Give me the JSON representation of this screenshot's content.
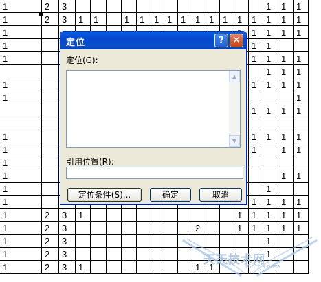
{
  "spreadsheet": {
    "rows": [
      [
        "1",
        "2",
        "3",
        "",
        "",
        "",
        "",
        "",
        "",
        "",
        "",
        "",
        "",
        "",
        "",
        "",
        "1",
        "1",
        "1"
      ],
      [
        "1",
        "2",
        "3",
        "1",
        "1",
        "",
        "1",
        "1",
        "1",
        "1",
        "1",
        "1",
        "1",
        "1",
        "1",
        "1",
        "1",
        "1",
        "1"
      ],
      [
        "1",
        "",
        "",
        "",
        "",
        "",
        "",
        "",
        "",
        "",
        "",
        "",
        "",
        "",
        "1",
        "1",
        "1",
        "1",
        "1"
      ],
      [
        "1",
        "",
        "",
        "",
        "",
        "",
        "",
        "",
        "",
        "",
        "",
        "",
        "",
        "",
        "1",
        "1",
        "1",
        "",
        ""
      ],
      [
        "1",
        "",
        "",
        "",
        "",
        "",
        "",
        "",
        "",
        "",
        "",
        "",
        "",
        "",
        "1",
        "1",
        "1",
        "1",
        "1"
      ],
      [
        "",
        "",
        "",
        "",
        "",
        "",
        "",
        "",
        "",
        "",
        "",
        "",
        "",
        "",
        "",
        "",
        "1",
        "1",
        "1"
      ],
      [
        "1",
        "",
        "",
        "",
        "",
        "",
        "",
        "",
        "",
        "",
        "",
        "",
        "",
        "",
        "1",
        "1",
        "1",
        "1",
        "1"
      ],
      [
        "1",
        "",
        "",
        "",
        "",
        "",
        "",
        "",
        "",
        "",
        "",
        "",
        "",
        "",
        "",
        "",
        "",
        "",
        "1"
      ],
      [
        "",
        "",
        "",
        "",
        "",
        "",
        "",
        "",
        "",
        "",
        "",
        "",
        "",
        "",
        "1",
        "1",
        "1",
        "1",
        "1"
      ],
      [
        "",
        "",
        "",
        "",
        "",
        "",
        "",
        "",
        "",
        "",
        "",
        "",
        "",
        "",
        "",
        "",
        "",
        "",
        ""
      ],
      [
        "1",
        "",
        "",
        "",
        "",
        "",
        "",
        "",
        "",
        "",
        "",
        "",
        "",
        "",
        "1",
        "1",
        "1",
        "1",
        "1"
      ],
      [
        "1",
        "",
        "",
        "",
        "",
        "",
        "",
        "",
        "",
        "",
        "",
        "",
        "",
        "",
        "1",
        "1",
        "",
        "1",
        "1"
      ],
      [
        "1",
        "",
        "",
        "",
        "",
        "",
        "",
        "",
        "",
        "",
        "",
        "",
        "",
        "",
        "1",
        "",
        "",
        "",
        ""
      ],
      [
        "1",
        "",
        "",
        "",
        "",
        "",
        "",
        "",
        "",
        "",
        "",
        "",
        "",
        "",
        "",
        "",
        "",
        "1",
        "1"
      ],
      [
        "1",
        "",
        "",
        "",
        "",
        "",
        "",
        "",
        "",
        "",
        "",
        "",
        "",
        "",
        "",
        "",
        "1",
        "",
        ""
      ],
      [
        "1",
        "",
        "",
        "",
        "",
        "",
        "",
        "",
        "",
        "",
        "",
        "",
        "",
        "",
        "1",
        "1",
        "1",
        "1",
        "1"
      ],
      [
        "1",
        "2",
        "3",
        "1",
        "",
        "",
        "",
        "",
        "",
        "",
        "",
        "",
        "",
        "",
        "1",
        "1",
        "1",
        "1",
        "1"
      ],
      [
        "1",
        "2",
        "3",
        "",
        "",
        "",
        "",
        "",
        "",
        "",
        "",
        "2",
        "",
        "",
        "1",
        "1",
        "1",
        "1",
        "1"
      ],
      [
        "1",
        "2",
        "3",
        "",
        "",
        "",
        "",
        "",
        "",
        "",
        "",
        "",
        "",
        "",
        "",
        "",
        "1",
        "",
        ""
      ],
      [
        "1",
        "2",
        "3",
        "",
        "",
        "",
        "",
        "",
        "",
        "",
        "",
        "",
        "",
        "",
        "",
        "",
        "1",
        "",
        ""
      ],
      [
        "1",
        "2",
        "3",
        "1",
        "",
        "",
        "",
        "",
        "",
        "",
        "",
        "1",
        "1",
        "",
        "",
        "",
        "",
        "",
        ""
      ]
    ]
  },
  "dialog": {
    "title": "定位",
    "help_glyph": "?",
    "close_glyph": "✕",
    "goto_label": "定位(G):",
    "goto_items": [],
    "reference_label": "引用位置(R):",
    "reference_value": "",
    "special_button": "定位条件(S)...",
    "ok_button": "确定",
    "cancel_button": "取消",
    "scroll_up_icon": "▲",
    "scroll_down_icon": "▼"
  },
  "watermark": {
    "text": "天天技术网",
    "subtext": "365ttjs.com"
  }
}
